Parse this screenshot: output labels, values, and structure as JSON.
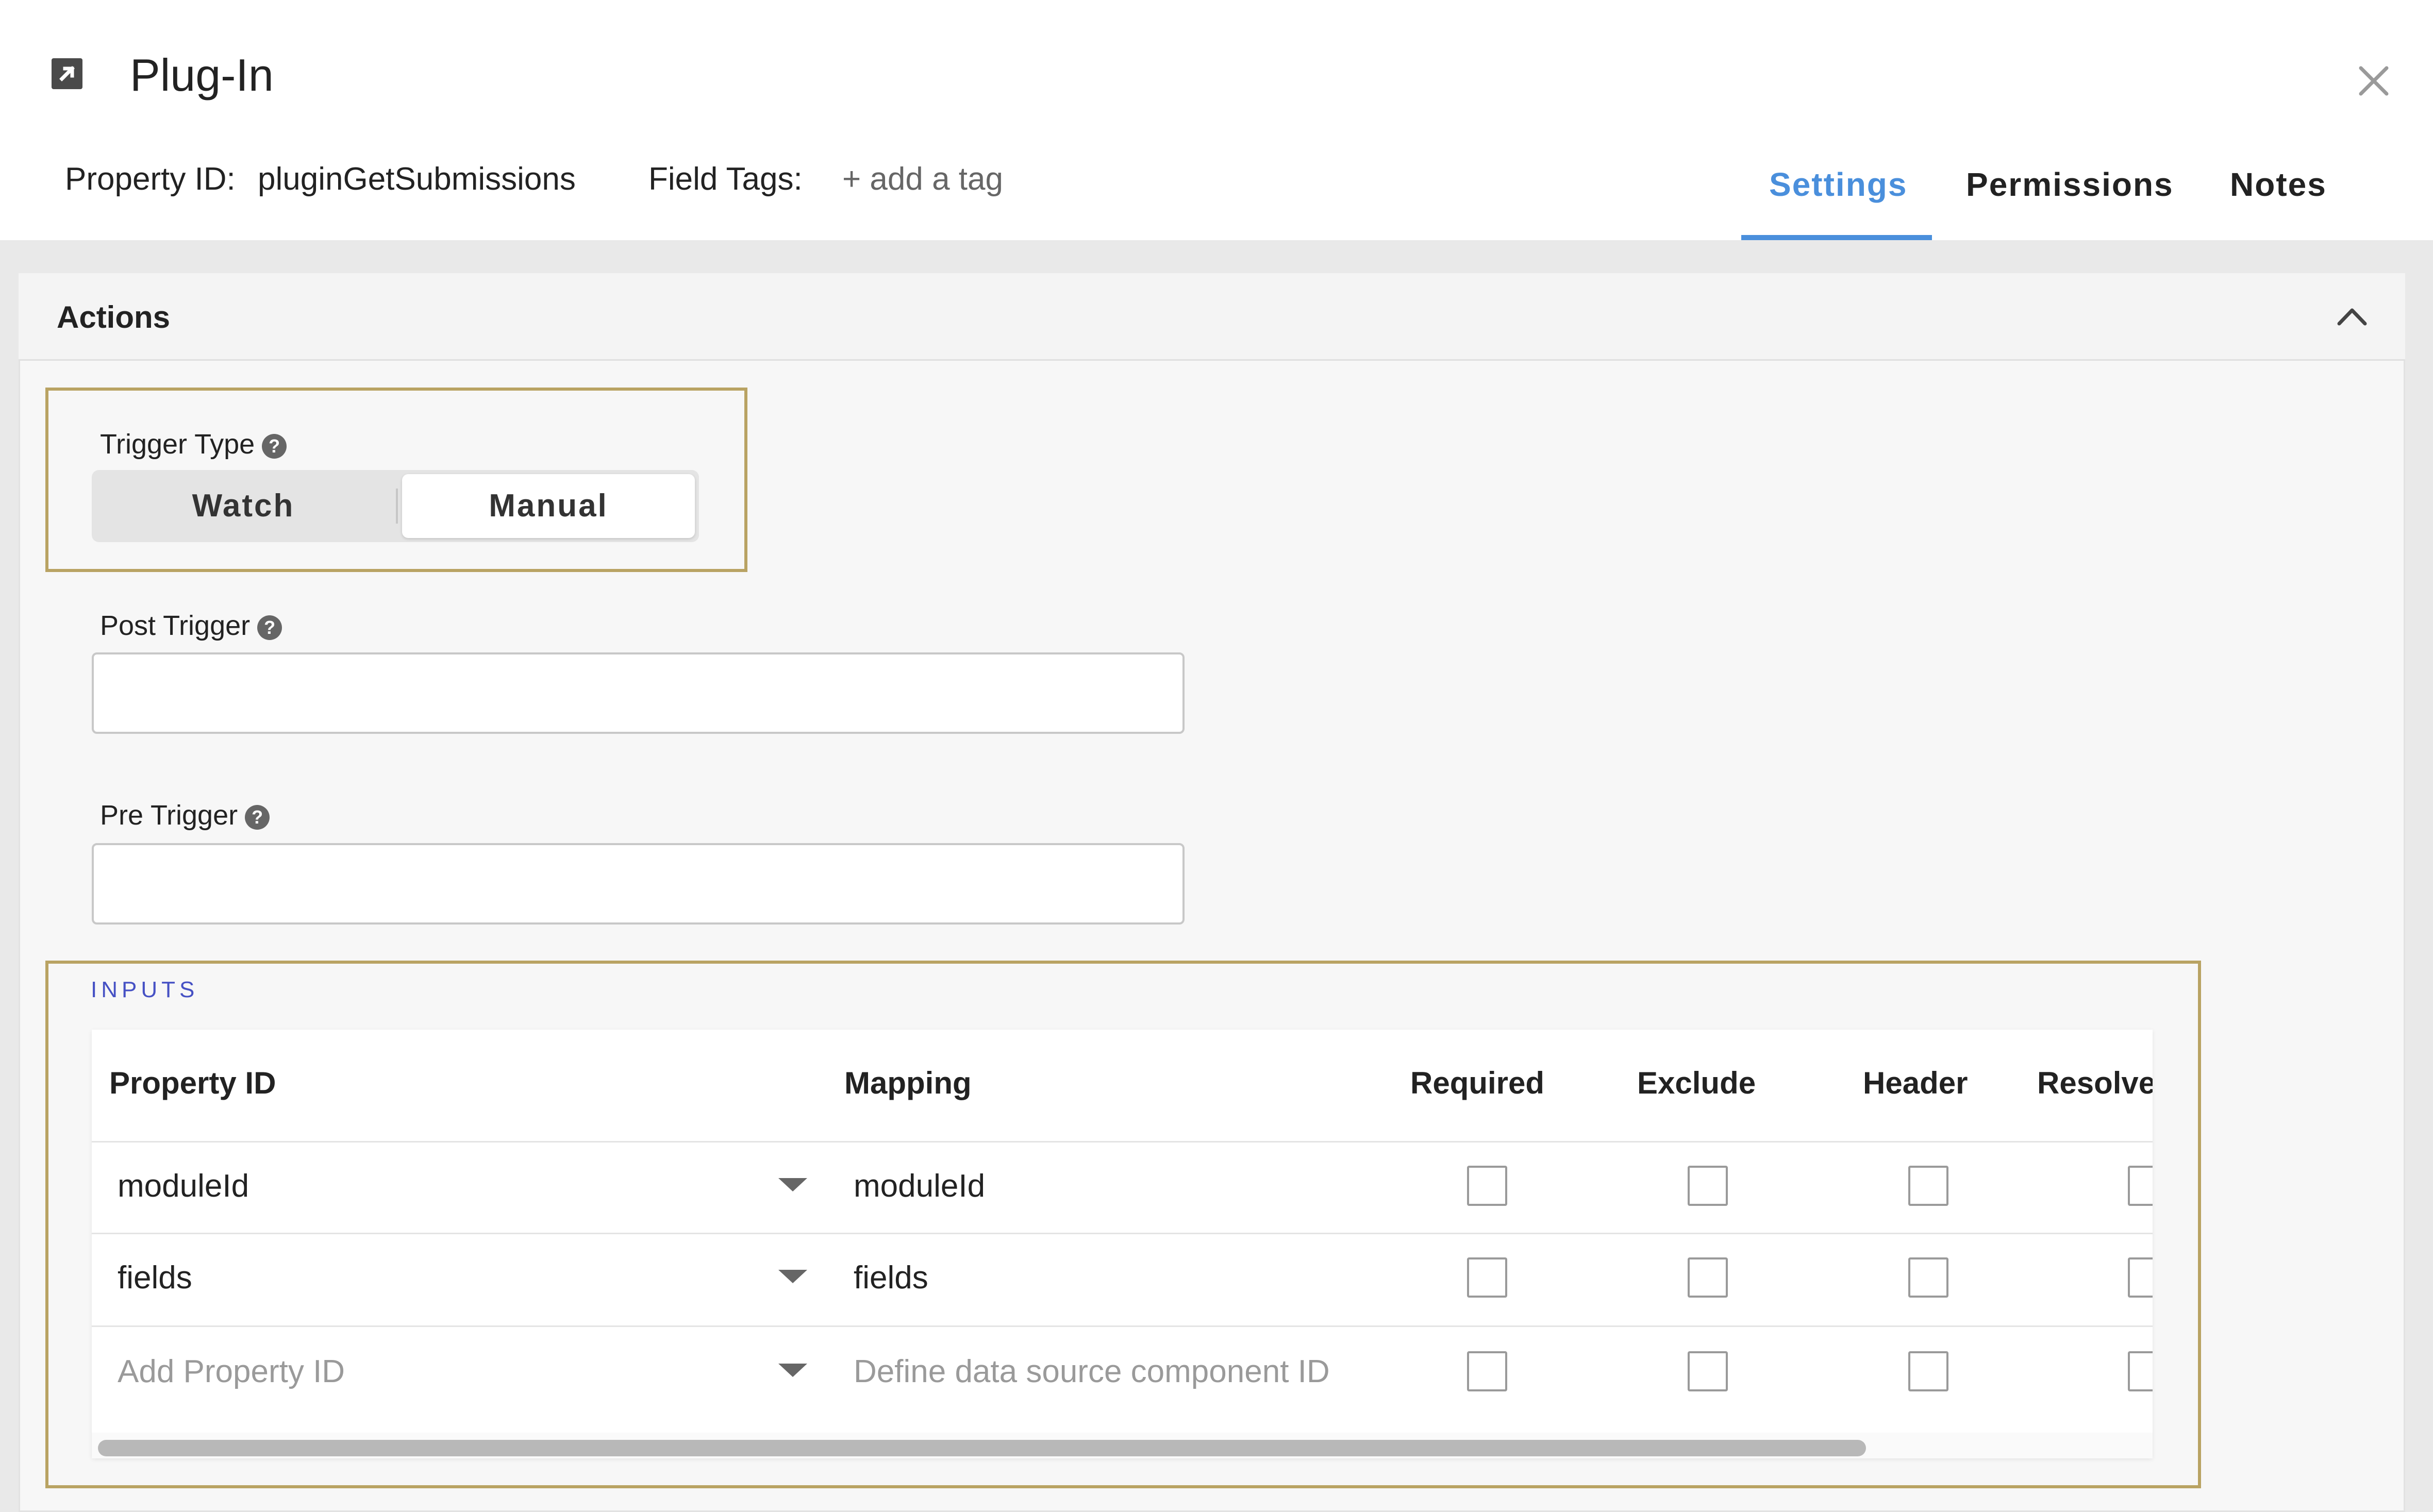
{
  "header": {
    "title": "Plug-In",
    "property_id_label": "Property ID:",
    "property_id_value": "pluginGetSubmissions",
    "field_tags_label": "Field Tags:",
    "add_tag": "+ add a tag"
  },
  "tabs": [
    {
      "label": "Settings",
      "active": true
    },
    {
      "label": "Permissions",
      "active": false
    },
    {
      "label": "Notes",
      "active": false
    }
  ],
  "section": {
    "title": "Actions",
    "expanded": true
  },
  "trigger_type": {
    "label": "Trigger Type",
    "options": [
      "Watch",
      "Manual"
    ],
    "selected": "Manual"
  },
  "post_trigger": {
    "label": "Post Trigger",
    "value": ""
  },
  "pre_trigger": {
    "label": "Pre Trigger",
    "value": ""
  },
  "inputs": {
    "section_label": "INPUTS",
    "columns": [
      "Property ID",
      "Mapping",
      "Required",
      "Exclude",
      "Header",
      "Resolve"
    ],
    "rows": [
      {
        "property_id": "moduleId",
        "mapping": "moduleId",
        "required": false,
        "exclude": false,
        "header": false,
        "resolve": false
      },
      {
        "property_id": "fields",
        "mapping": "fields",
        "required": false,
        "exclude": false,
        "header": false,
        "resolve": false
      }
    ],
    "new_row": {
      "property_id_placeholder": "Add Property ID",
      "mapping_placeholder": "Define data source component ID"
    }
  },
  "colors": {
    "accent": "#4a8fdc",
    "highlight": "#b9a363",
    "inputs_label": "#4651c4"
  },
  "icons": [
    "external-link-icon",
    "close-icon",
    "chevron-up-icon",
    "help-icon",
    "caret-down-icon"
  ]
}
